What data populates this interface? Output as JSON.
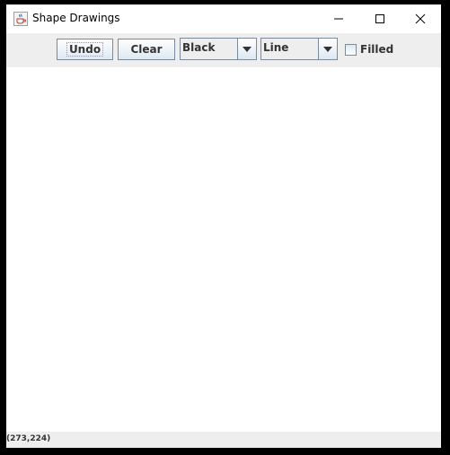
{
  "window": {
    "title": "Shape Drawings",
    "icon": "java-cup-icon"
  },
  "title_buttons": {
    "minimize": "minimize-icon",
    "maximize": "maximize-icon",
    "close": "close-icon"
  },
  "toolbar": {
    "undo_label": "Undo",
    "clear_label": "Clear",
    "color_select": {
      "selected": "Black"
    },
    "shape_select": {
      "selected": "Line"
    },
    "filled": {
      "label": "Filled",
      "checked": false
    }
  },
  "status": {
    "coordinates": "(273,224)"
  },
  "colors": {
    "toolbar_bg": "#eeeeee",
    "canvas_bg": "#ffffff",
    "border": "#7a8a99",
    "text": "#333333"
  }
}
